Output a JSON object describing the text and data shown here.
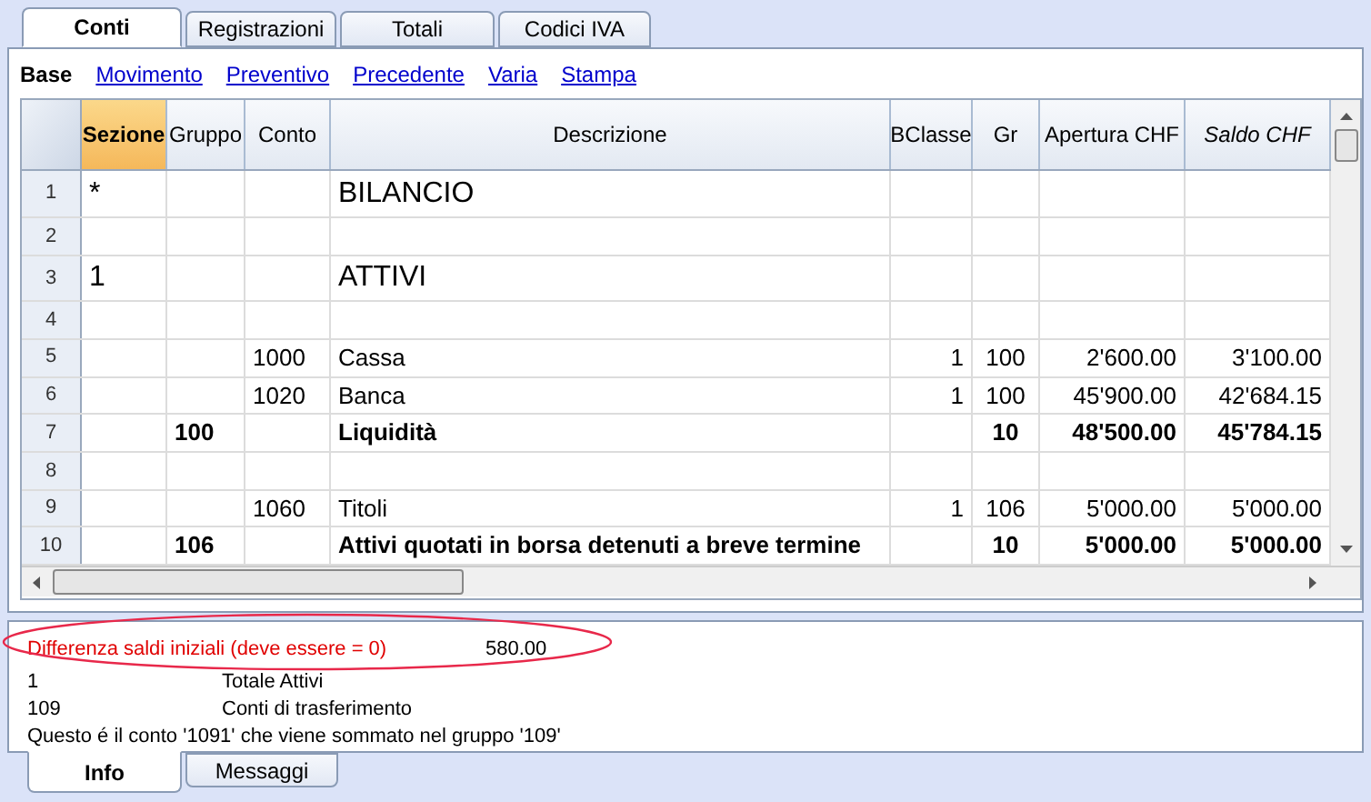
{
  "tabs": [
    {
      "label": "Conti",
      "selected": true
    },
    {
      "label": "Registrazioni",
      "selected": false
    },
    {
      "label": "Totali",
      "selected": false
    },
    {
      "label": "Codici IVA",
      "selected": false
    }
  ],
  "views": [
    {
      "label": "Base",
      "selected": true
    },
    {
      "label": "Movimento",
      "selected": false
    },
    {
      "label": "Preventivo",
      "selected": false
    },
    {
      "label": "Precedente",
      "selected": false
    },
    {
      "label": "Varia",
      "selected": false
    },
    {
      "label": "Stampa",
      "selected": false
    }
  ],
  "table": {
    "columns": [
      {
        "label": "Sezione",
        "selected": true,
        "italic": false
      },
      {
        "label": "Gruppo",
        "selected": false,
        "italic": false
      },
      {
        "label": "Conto",
        "selected": false,
        "italic": false
      },
      {
        "label": "Descrizione",
        "selected": false,
        "italic": false
      },
      {
        "label": "BClasse",
        "selected": false,
        "italic": false
      },
      {
        "label": "Gr",
        "selected": false,
        "italic": false
      },
      {
        "label": "Apertura CHF",
        "selected": false,
        "italic": false
      },
      {
        "label": "Saldo CHF",
        "selected": false,
        "italic": true
      }
    ],
    "rows": [
      {
        "kind": "heading",
        "number": "1",
        "cells": [
          "*",
          "",
          "",
          "BILANCIO",
          "",
          "",
          "",
          ""
        ]
      },
      {
        "kind": "blank",
        "number": "2",
        "cells": [
          "",
          "",
          "",
          "",
          "",
          "",
          "",
          ""
        ]
      },
      {
        "kind": "heading",
        "number": "3",
        "cells": [
          "1",
          "",
          "",
          "ATTIVI",
          "",
          "",
          "",
          ""
        ]
      },
      {
        "kind": "blank",
        "number": "4",
        "cells": [
          "",
          "",
          "",
          "",
          "",
          "",
          "",
          ""
        ]
      },
      {
        "kind": "account",
        "number": "5",
        "cells": [
          "",
          "",
          "1000",
          "Cassa",
          "1",
          "100",
          "2'600.00",
          "3'100.00"
        ]
      },
      {
        "kind": "account",
        "number": "6",
        "cells": [
          "",
          "",
          "1020",
          "Banca",
          "1",
          "100",
          "45'900.00",
          "42'684.15"
        ]
      },
      {
        "kind": "total",
        "number": "7",
        "cells": [
          "",
          "100",
          "",
          "Liquidità",
          "",
          "10",
          "48'500.00",
          "45'784.15"
        ]
      },
      {
        "kind": "blank",
        "number": "8",
        "cells": [
          "",
          "",
          "",
          "",
          "",
          "",
          "",
          ""
        ]
      },
      {
        "kind": "account",
        "number": "9",
        "cells": [
          "",
          "",
          "1060",
          "Titoli",
          "1",
          "106",
          "5'000.00",
          "5'000.00"
        ]
      },
      {
        "kind": "total",
        "number": "10",
        "cells": [
          "",
          "106",
          "",
          "Attivi quotati in borsa detenuti a breve termine",
          "",
          "10",
          "5'000.00",
          "5'000.00"
        ]
      }
    ]
  },
  "info": {
    "lines": [
      {
        "kind": "warning",
        "text": "Differenza saldi iniziali (deve essere = 0)",
        "value": "580.00"
      },
      {
        "kind": "pair",
        "text": "1",
        "value": "Totale Attivi"
      },
      {
        "kind": "pair",
        "text": "109",
        "value": "Conti di trasferimento"
      },
      {
        "kind": "sentence",
        "text": "Questo é il conto '1091' che viene sommato nel gruppo '109'"
      }
    ]
  },
  "bottom_tabs": [
    {
      "label": "Info",
      "selected": true
    },
    {
      "label": "Messaggi",
      "selected": false
    }
  ]
}
